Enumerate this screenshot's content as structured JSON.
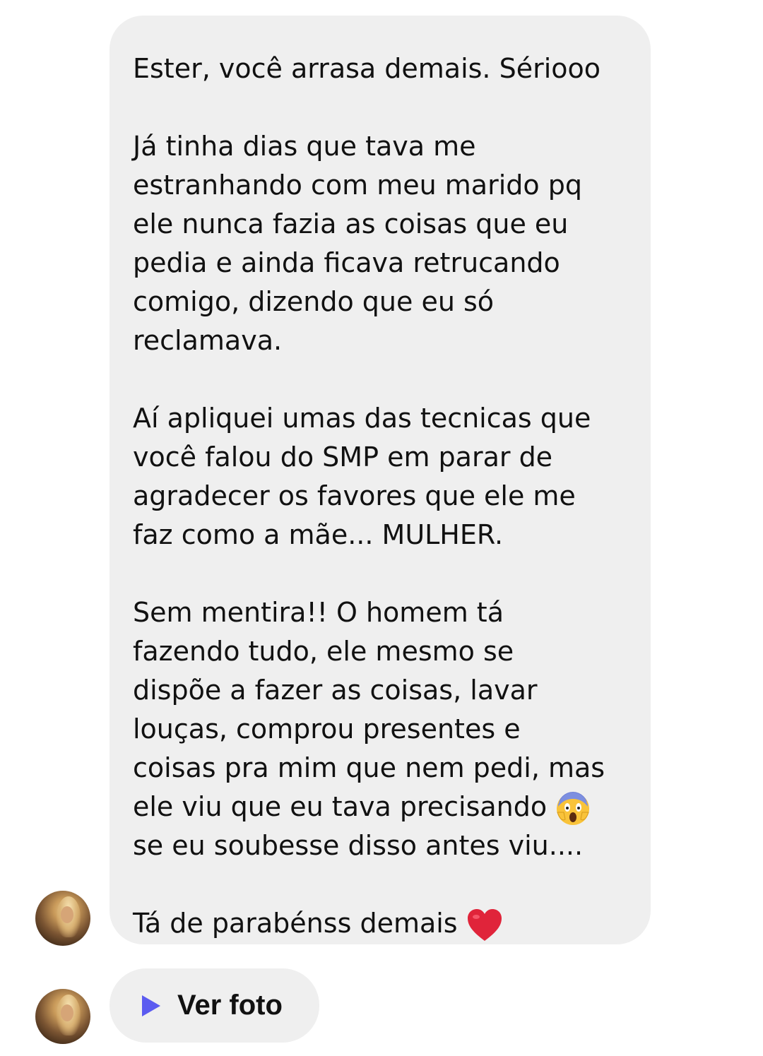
{
  "message": {
    "paragraphs": [
      "Ester, você arrasa demais. Sériooo",
      "Já tinha dias que tava me\nestranhando com meu marido pq\nele nunca fazia as coisas que eu\npedia e ainda ficava retrucando\ncomigo, dizendo que eu só\nreclamava.",
      "Aí apliquei umas das tecnicas que\nvocê falou do SMP em parar de\nagradecer os favores que ele me\nfaz como a mãe... MULHER.",
      "Sem mentira!! O homem tá\nfazendo tudo, ele mesmo se\ndispõe a fazer as coisas, lavar\nlouças, comprou presentes e\ncoisas pra mim que nem pedi, mas\nele viu que eu tava precisando",
      "se eu soubesse disso antes viu....",
      "Tá de parabénss demais"
    ],
    "emojis": {
      "shocked": "face-screaming-in-fear-icon",
      "heart": "red-heart-icon"
    }
  },
  "photo_message": {
    "label": "Ver foto",
    "icon": "play-icon",
    "accent": "#5b5bf0"
  },
  "colors": {
    "bubble": "#efefef",
    "text": "#111111",
    "heart": "#e0243a"
  }
}
